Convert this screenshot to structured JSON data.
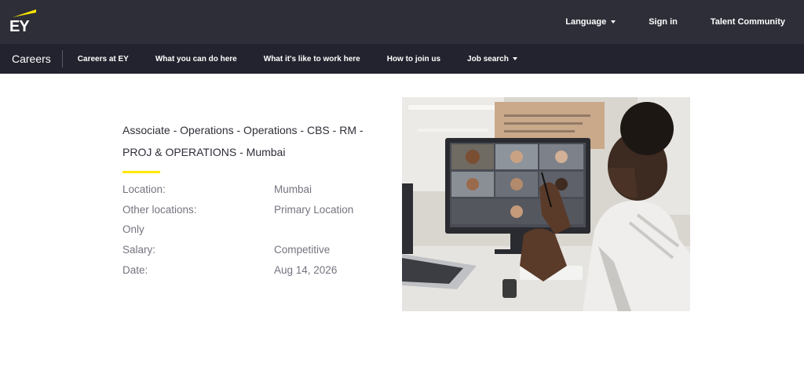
{
  "header": {
    "logo_text": "EY",
    "links": [
      {
        "label": "Language",
        "has_dropdown": true
      },
      {
        "label": "Sign in",
        "has_dropdown": false
      },
      {
        "label": "Talent Community",
        "has_dropdown": false
      }
    ]
  },
  "nav": {
    "brand": "Careers",
    "items": [
      {
        "label": "Careers at EY",
        "has_dropdown": false
      },
      {
        "label": "What you can do here",
        "has_dropdown": false
      },
      {
        "label": "What it's like to work here",
        "has_dropdown": false
      },
      {
        "label": "How to join us",
        "has_dropdown": false
      },
      {
        "label": "Job search",
        "has_dropdown": true
      }
    ]
  },
  "job": {
    "title_line1": "Associate - Operations - Operations - CBS - RM -",
    "title_line2": "PROJ & OPERATIONS - Mumbai",
    "location_label": "Location:",
    "location_value": "Mumbai",
    "other_locations_label": "Other locations:",
    "other_locations_value": "Primary Location",
    "other_locations_suffix": "Only",
    "salary_label": "Salary:",
    "salary_value": "Competitive",
    "date_label": "Date:",
    "date_value": "Aug 14, 2026"
  },
  "colors": {
    "header_bg": "#2e2e38",
    "nav_bg": "#23232f",
    "accent_yellow": "#ffe600",
    "title_text": "#2e2e38",
    "detail_text": "#747480"
  },
  "icons": {
    "logo": "ey-beam-logo",
    "dropdown": "caret-down-icon"
  }
}
